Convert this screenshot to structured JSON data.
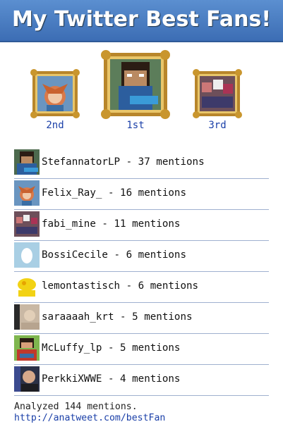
{
  "header": {
    "title": "My Twitter Best Fans!"
  },
  "podium": [
    {
      "place": "2nd",
      "avatar": "orange-haired-character-avatar"
    },
    {
      "place": "1st",
      "avatar": "minecraft-skin-avatar"
    },
    {
      "place": "3rd",
      "avatar": "minecraft-group-avatar"
    }
  ],
  "fans": [
    {
      "text": "StefannatorLP - 37 mentions",
      "avatar": "minecraft-skin-avatar"
    },
    {
      "text": "Felix_Ray_ - 16 mentions",
      "avatar": "orange-haired-character-avatar"
    },
    {
      "text": "fabi_mine - 11 mentions",
      "avatar": "minecraft-group-avatar"
    },
    {
      "text": "BossiCecile - 6 mentions",
      "avatar": "default-egg-avatar"
    },
    {
      "text": "lemontastisch - 6 mentions",
      "avatar": "yellow-blob-avatar"
    },
    {
      "text": "saraaaah_krt - 5 mentions",
      "avatar": "blurry-photo-avatar"
    },
    {
      "text": "McLuffy_lp - 5 mentions",
      "avatar": "minecraft-luffy-avatar"
    },
    {
      "text": "PerkkiXWWE - 4 mentions",
      "avatar": "person-photo-avatar"
    }
  ],
  "footer": {
    "analyzed": "Analyzed 144 mentions.",
    "link": "http://anatweet.com/bestFan"
  },
  "colors": {
    "header": "#4a7fc5",
    "link": "#1a3fa8",
    "frame_gold": "#b8862b"
  }
}
